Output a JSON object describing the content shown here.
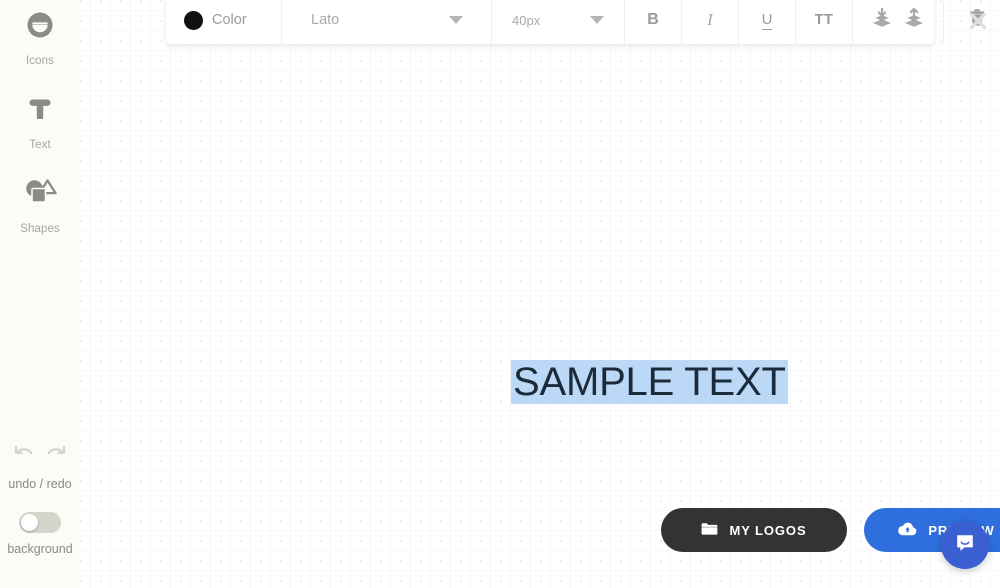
{
  "app": {
    "canvas_background": "#ffffff",
    "accent_color": "#2f6fdd",
    "dark_button_color": "#333333"
  },
  "sidebar": {
    "tools": [
      {
        "id": "icons",
        "label": "Icons",
        "icon": "icons-shape-icon"
      },
      {
        "id": "text",
        "label": "Text",
        "icon": "text-t-icon"
      },
      {
        "id": "shapes",
        "label": "Shapes",
        "icon": "shapes-icon"
      }
    ],
    "history": {
      "label": "undo / redo",
      "undo_icon": "undo-arrow-icon",
      "redo_icon": "redo-arrow-icon"
    },
    "background": {
      "label": "background",
      "toggle_state": "off"
    }
  },
  "toolbar": {
    "color": {
      "label": "Color",
      "swatch_hex": "#111111",
      "icon": "color-swatch-icon"
    },
    "font": {
      "value": "Lato",
      "caret_icon": "chevron-down-icon"
    },
    "size": {
      "value": "40px",
      "caret_icon": "chevron-down-icon"
    },
    "bold_label": "B",
    "italic_label": "I",
    "underline_label": "U",
    "caps_label": "TT",
    "send_backward_icon": "send-to-back-icon",
    "bring_forward_icon": "bring-to-front-icon",
    "delete_icon": "trash-icon",
    "close_icon": "close-icon"
  },
  "canvas": {
    "text_object": {
      "content": "SAMPLE TEXT",
      "selected": true,
      "selection_hex": "#bcd8f7",
      "text_hex": "#1b2b3a",
      "font_size": "40px"
    }
  },
  "actions": {
    "my_logos_label": "MY LOGOS",
    "my_logos_icon": "folder-icon",
    "preview_label": "PREVIEW",
    "preview_icon": "cloud-upload-icon"
  },
  "support": {
    "chat_icon": "chat-bubble-icon"
  }
}
